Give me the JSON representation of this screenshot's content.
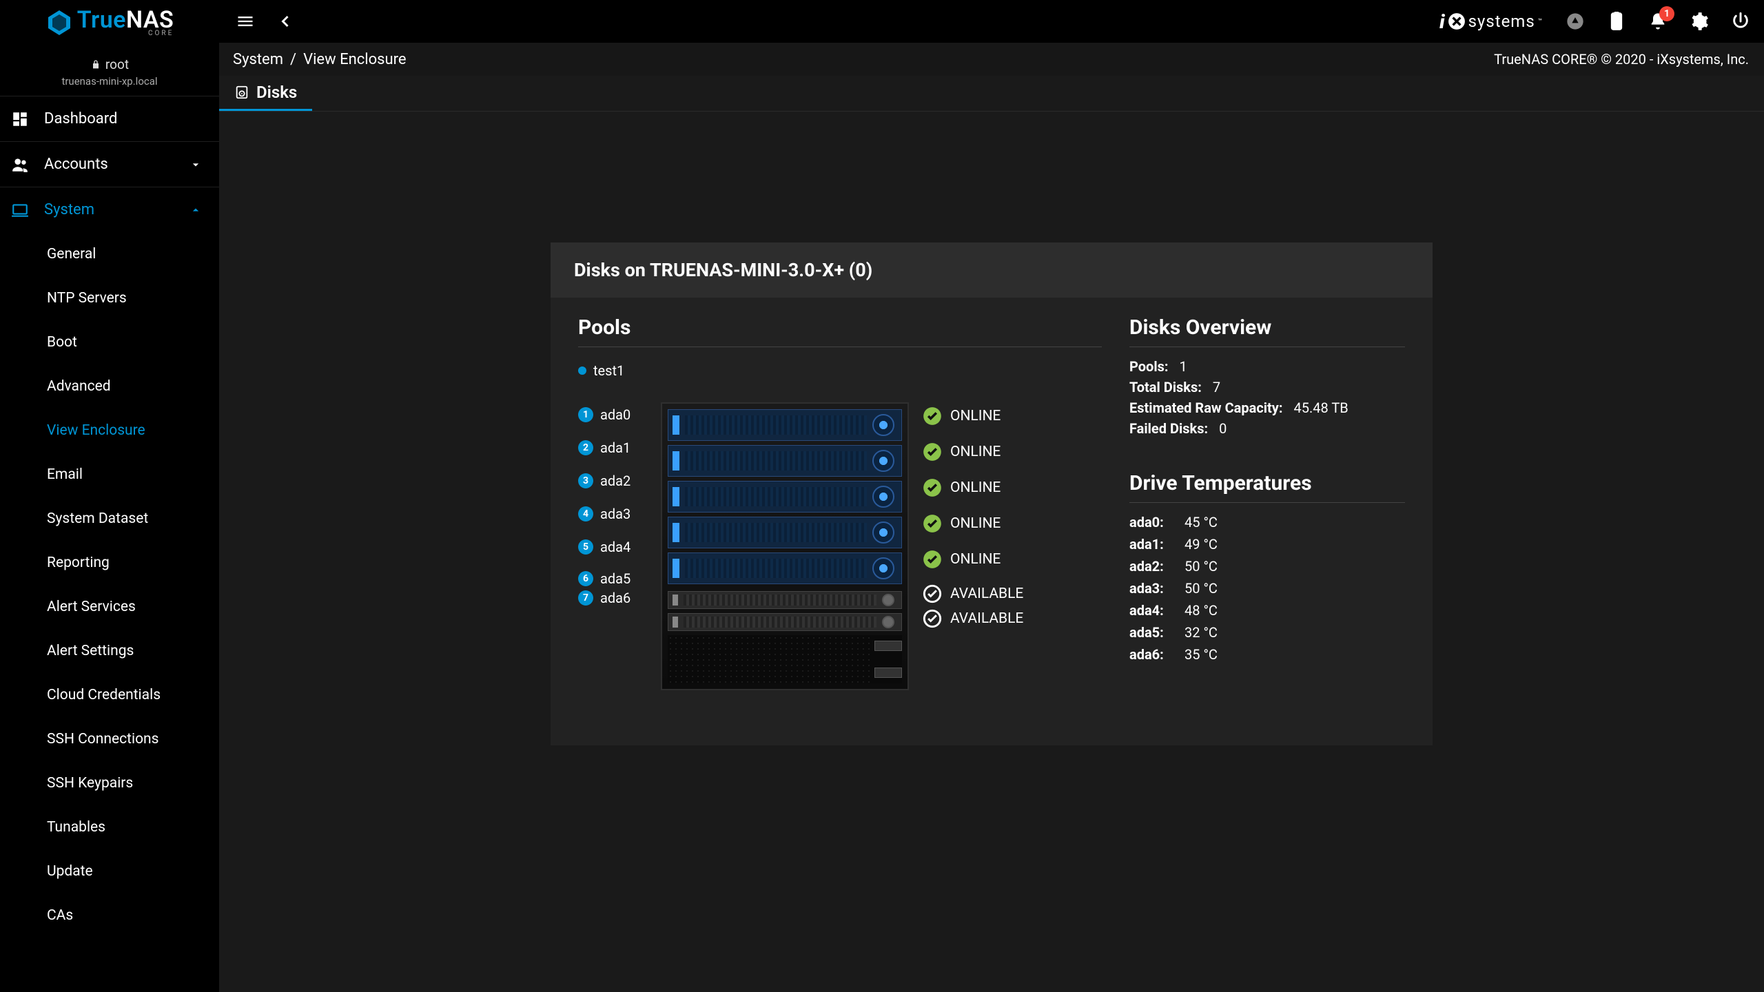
{
  "brand": {
    "name_blue": "True",
    "name_white": "NAS",
    "sub": "CORE"
  },
  "ixsystems": "systems",
  "notifications": {
    "count": "1"
  },
  "breadcrumb": {
    "root": "System",
    "page": "View Enclosure",
    "right": "TrueNAS CORE® © 2020 - iXsystems, Inc."
  },
  "user": {
    "name": "root",
    "host": "truenas-mini-xp.local"
  },
  "sidebar": {
    "dashboard": "Dashboard",
    "accounts": "Accounts",
    "system": "System",
    "system_children": [
      "General",
      "NTP Servers",
      "Boot",
      "Advanced",
      "View Enclosure",
      "Email",
      "System Dataset",
      "Reporting",
      "Alert Services",
      "Alert Settings",
      "Cloud Credentials",
      "SSH Connections",
      "SSH Keypairs",
      "Tunables",
      "Update",
      "CAs"
    ]
  },
  "tab": {
    "disks": "Disks"
  },
  "card": {
    "title": "Disks on TRUENAS-MINI-3.0-X+ (0)",
    "pools_title": "Pools",
    "pools": [
      {
        "name": "test1"
      }
    ],
    "disks": [
      {
        "n": "1",
        "id": "ada0",
        "status": "ONLINE"
      },
      {
        "n": "2",
        "id": "ada1",
        "status": "ONLINE"
      },
      {
        "n": "3",
        "id": "ada2",
        "status": "ONLINE"
      },
      {
        "n": "4",
        "id": "ada3",
        "status": "ONLINE"
      },
      {
        "n": "5",
        "id": "ada4",
        "status": "ONLINE"
      }
    ],
    "disks_small": [
      {
        "n": "6",
        "id": "ada5",
        "status": "AVAILABLE"
      },
      {
        "n": "7",
        "id": "ada6",
        "status": "AVAILABLE"
      }
    ],
    "overview_title": "Disks Overview",
    "overview": [
      {
        "k": "Pools:",
        "v": "1"
      },
      {
        "k": "Total Disks:",
        "v": "7"
      },
      {
        "k": "Estimated Raw Capacity:",
        "v": "45.48 TB"
      },
      {
        "k": "Failed Disks:",
        "v": "0"
      }
    ],
    "temps_title": "Drive Temperatures",
    "temps": [
      {
        "k": "ada0:",
        "v": "45 °C"
      },
      {
        "k": "ada1:",
        "v": "49 °C"
      },
      {
        "k": "ada2:",
        "v": "50 °C"
      },
      {
        "k": "ada3:",
        "v": "50 °C"
      },
      {
        "k": "ada4:",
        "v": "48 °C"
      },
      {
        "k": "ada5:",
        "v": "32 °C"
      },
      {
        "k": "ada6:",
        "v": "35 °C"
      }
    ]
  }
}
